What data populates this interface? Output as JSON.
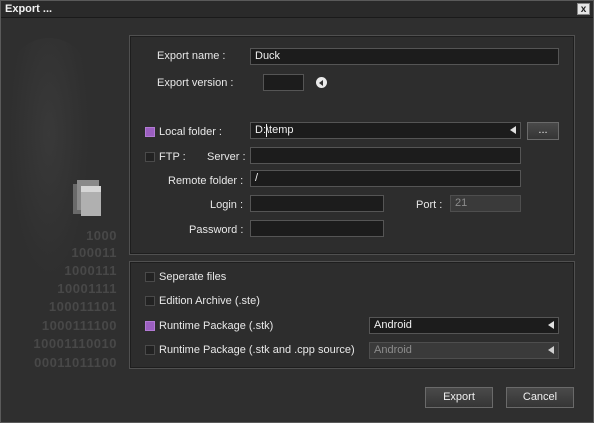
{
  "window": {
    "title": "Export ...",
    "close_label": "x"
  },
  "background": {
    "binary_lines": [
      "1000",
      "100011",
      "1000111",
      "10001111",
      "100011101",
      "1000111100",
      "10001110010",
      "00011011100"
    ]
  },
  "form": {
    "export_name_label": "Export name :",
    "export_name_value": "Duck",
    "export_version_label": "Export version :",
    "export_version_value": "",
    "local_folder_label": "Local folder :",
    "local_folder_checked": true,
    "local_folder_value": "D:\\temp",
    "browse_label": "...",
    "ftp_label": "FTP :",
    "ftp_checked": false,
    "server_label": "Server :",
    "server_value": "",
    "remote_folder_label": "Remote folder :",
    "remote_folder_value": "/",
    "login_label": "Login :",
    "login_value": "",
    "port_label": "Port :",
    "port_value": "21",
    "password_label": "Password :",
    "password_value": ""
  },
  "options": {
    "separate_files_label": "Seperate files",
    "separate_files_checked": false,
    "edition_archive_label": "Edition Archive (.ste)",
    "edition_archive_checked": false,
    "runtime_package_label": "Runtime Package (.stk)",
    "runtime_package_checked": true,
    "runtime_package_platform": "Android",
    "runtime_source_label": "Runtime Package (.stk and .cpp source)",
    "runtime_source_checked": false,
    "runtime_source_platform": "Android"
  },
  "buttons": {
    "export_label": "Export",
    "cancel_label": "Cancel"
  },
  "colors": {
    "accent_checkbox": "#9b5fc0",
    "background": "#2f2f2f",
    "field": "#1c1c1c"
  }
}
